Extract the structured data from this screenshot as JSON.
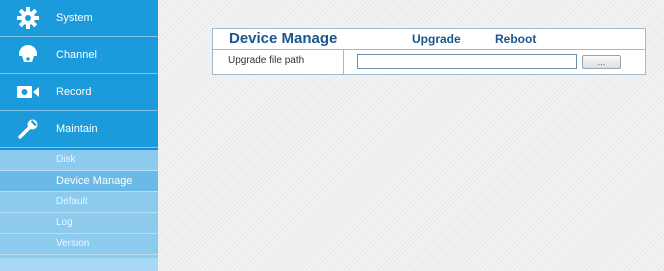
{
  "sidebar": {
    "main": [
      {
        "label": "System",
        "icon": "gear-icon"
      },
      {
        "label": "Channel",
        "icon": "dome-camera-icon"
      },
      {
        "label": "Record",
        "icon": "video-camera-icon"
      },
      {
        "label": "Maintain",
        "icon": "wrench-icon"
      }
    ],
    "sub": [
      {
        "label": "Disk"
      },
      {
        "label": "Device Manage",
        "active": true
      },
      {
        "label": "Default"
      },
      {
        "label": "Log"
      },
      {
        "label": "Version"
      }
    ]
  },
  "panel": {
    "title": "Device Manage",
    "tabs": [
      "Upgrade",
      "Reboot"
    ],
    "row_label": "Upgrade file path",
    "path_value": "",
    "browse_label": "..."
  },
  "colors": {
    "sidebar_main": "#1b9bdc",
    "sidebar_sub": "#8ccbee",
    "sidebar_active": "#6ab9e6",
    "title_text": "#1b5590",
    "panel_border": "#9fb9cf"
  }
}
